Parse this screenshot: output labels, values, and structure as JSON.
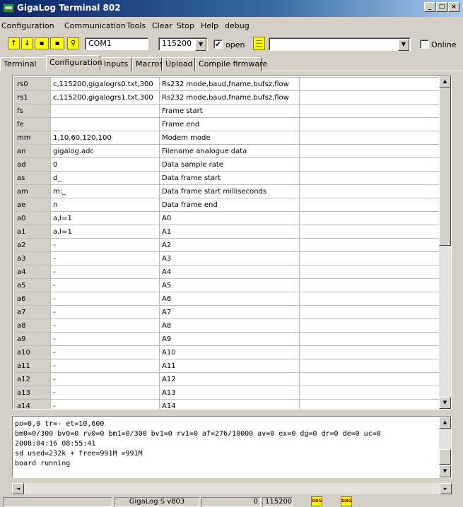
{
  "window": {
    "title": "GigaLog Terminal 802"
  },
  "menu": [
    "Configuration",
    "Communication",
    "Tools",
    "Clear",
    "Stop",
    "Help",
    "debug"
  ],
  "toolbar": {
    "port": "COM1",
    "baud": "115200",
    "open_label": "open",
    "open_checked": "✔",
    "command_value": "",
    "online_label": "Online"
  },
  "tabs": [
    "Terminal",
    "Configuration",
    "Inputs",
    "Macros",
    "Upload",
    "Compile firmware"
  ],
  "grid": {
    "rows": [
      [
        "rs0",
        "c,115200,gigalogrs0.txt,300",
        "Rs232 mode,baud,fname,bufsz,flow",
        ""
      ],
      [
        "rs1",
        "c,115200,gigalogrs1.txt,300",
        "Rs232 mode,baud,fname,bufsz,flow",
        ""
      ],
      [
        "fs",
        "",
        "Frame start",
        ""
      ],
      [
        "fe",
        "",
        "Frame end",
        ""
      ],
      [
        "mm",
        "1,10,60,120,100",
        "Modem mode",
        ""
      ],
      [
        "an",
        "gigalog.adc",
        "Filename analogue data",
        ""
      ],
      [
        "ad",
        "0",
        "Data sample rate",
        ""
      ],
      [
        "as",
        "d_",
        "Data frame start",
        ""
      ],
      [
        "am",
        "m:_",
        "Data frame start milliseconds",
        ""
      ],
      [
        "ae",
        "n",
        "Data frame end",
        ""
      ],
      [
        "a0",
        "a,l=1",
        "A0",
        ""
      ],
      [
        "a1",
        "a,l=1",
        "A1",
        ""
      ],
      [
        "a2",
        "-",
        "A2",
        ""
      ],
      [
        "a3",
        "-",
        "A3",
        ""
      ],
      [
        "a4",
        "-",
        "A4",
        ""
      ],
      [
        "a5",
        "-",
        "A5",
        ""
      ],
      [
        "a6",
        "-",
        "A6",
        ""
      ],
      [
        "a7",
        "-",
        "A7",
        ""
      ],
      [
        "a8",
        "-",
        "A8",
        ""
      ],
      [
        "a9",
        "-",
        "A9",
        ""
      ],
      [
        "a10",
        "-",
        "A10",
        ""
      ],
      [
        "a11",
        "-",
        "A11",
        ""
      ],
      [
        "a12",
        "-",
        "A12",
        ""
      ],
      [
        "a13",
        "-",
        "A13",
        ""
      ],
      [
        "a14",
        "-",
        "A14",
        ""
      ]
    ]
  },
  "console": {
    "text": "po=0,0 tr=- et=10,600\nbm0=0/300 bv0=0 rv0=0 bm1=0/300 bv1=0 rv1=0 af=276/10000 av=0 ex=0 dg=0 dr=0 de=0 uc=0\n2008:04:16 08:55:41\nsd used=232k + free=991M =991M\nboard running"
  },
  "status": {
    "version": "GigaLog S v803",
    "counter": "0",
    "baud": "115200",
    "dbg1": "DBG",
    "dbg2": "DBG"
  },
  "icons": {
    "up": "arrow-up-icon",
    "down": "arrow-down-icon",
    "save1": "save-disk-icon",
    "save2": "save-disk-icon",
    "bell": "bell-icon",
    "note": "notepad-icon"
  }
}
